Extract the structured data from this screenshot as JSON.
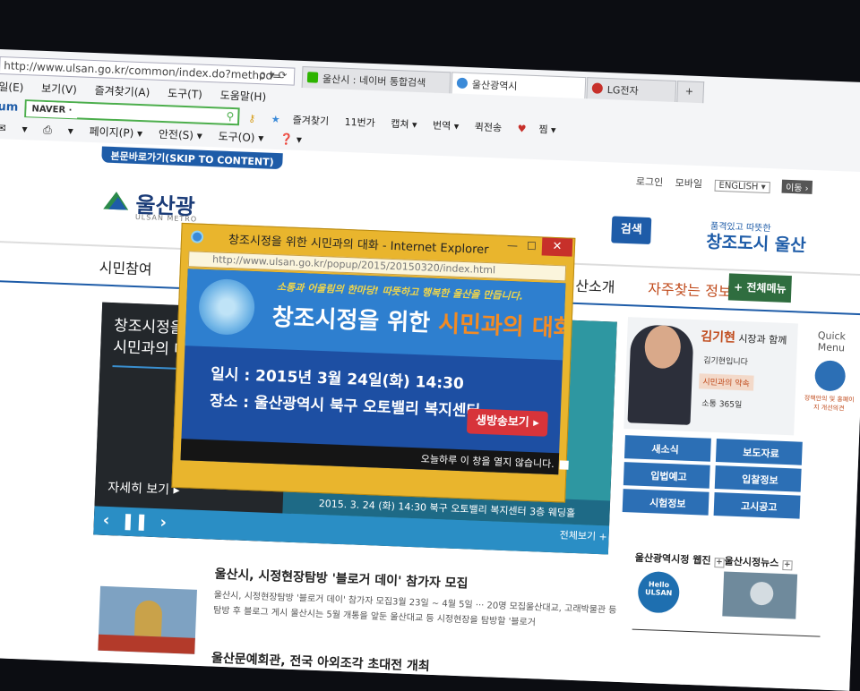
{
  "browser": {
    "address": "http://www.ulsan.go.kr/common/index.do?method=",
    "address_buttons": "ρ ▾ ⟳",
    "tabs": [
      {
        "label": "울산시 : 네이버 통합검색",
        "color": "#2db400"
      },
      {
        "label": "울산광역시",
        "color": "#3b8ad8"
      },
      {
        "label": "LG전자",
        "color": "#c7302a"
      }
    ],
    "menu": [
      "일(E)",
      "보기(V)",
      "즐겨찾기(A)",
      "도구(T)",
      "도움말(H)"
    ],
    "toolbar1": {
      "left_label": "um",
      "naver_label": "NAVER ·",
      "items": [
        "즐겨찾기",
        "11번가",
        "캡쳐 ▾",
        "번역 ▾",
        "퀵전송",
        "찜 ▾"
      ]
    },
    "toolbar2": [
      "▾",
      "▾",
      "페이지(P) ▾",
      "안전(S) ▾",
      "도구(O) ▾",
      "❓ ▾"
    ]
  },
  "page": {
    "skip_link": "본문바로가기(SKIP TO CONTENT)",
    "top_links": [
      "로그인",
      "모바일"
    ],
    "language": "ENGLISH ▾",
    "language_go": "이동 ›",
    "logo": "울산광",
    "logo_sub": "ULSAN METRO",
    "search_button": "검색",
    "slogan_small": "품격있고 따뜻한",
    "slogan": "창조도시 울산",
    "nav": [
      "시민참여",
      "산소개",
      "자주찾는 정보"
    ],
    "full_menu": "+ 전체메뉴",
    "banner": {
      "title_line1": "창조시정을",
      "title_line2": "시민과의 대",
      "more": "자세히 보기 ▸",
      "strip": "2015. 3. 24 (화) 14:30  북구 오토밸리 복지센터 3층 웨딩홀",
      "all_view": "전체보기 +",
      "controls": [
        "‹",
        "❚❚",
        "›"
      ]
    },
    "mayor": {
      "heading_name": "김기현",
      "heading_rest": " 시장과 함께",
      "items": [
        "김기현입니다",
        "시민과의 약속",
        "소통 365일"
      ]
    },
    "services": [
      "새소식",
      "보도자료",
      "입법예고",
      "입찰정보",
      "시험정보",
      "고시공고"
    ],
    "quick_menu": {
      "title_line1": "Quick",
      "title_line2": "Menu",
      "desc": "정책안의 및 홍폐이지 개선의견"
    },
    "webzine_label": "울산광역시정 웹진",
    "news_label": "울산시정뉴스",
    "hello_badge": "Hello ULSAN",
    "news": [
      {
        "title": "울산시, 시정현장탐방 '블로거 데이' 참가자 모집",
        "body": "울산시, 시정현장탐방 '블로거 데이' 참가자 모집3월 23일 ~ 4월 5일 ··· 20명 모집울산대교, 고래박물관 등 탐방 후 블로그 게시 울산시는 5월 개통을 앞둔 울산대교 등 시정현장을 탐방할 '블로거"
      },
      {
        "title": "울산문예회관, 전국 아외조각 초대전 개최",
        "body": ""
      }
    ]
  },
  "popup": {
    "window_title": "창조시정을 위한 시민과의 대화 - Internet Explorer",
    "url": "http://www.ulsan.go.kr/popup/2015/20150320/index.html",
    "tagline": "소통과 어울림의 한마당! 따뜻하고 행복한 울산을 만듭니다.",
    "headline_main": "창조시정을 위한 ",
    "headline_accent": "시민과의 대화",
    "date_line": "일시 : 2015년 3월 24일(화) 14:30",
    "place_line": "장소 : 울산광역시 북구 오토밸리 복지센터",
    "live_button": "생방송보기 ▸",
    "dont_show": "오늘하루 이 창을 열지 않습니다.",
    "min": "—",
    "max": "☐",
    "close": "✕"
  }
}
